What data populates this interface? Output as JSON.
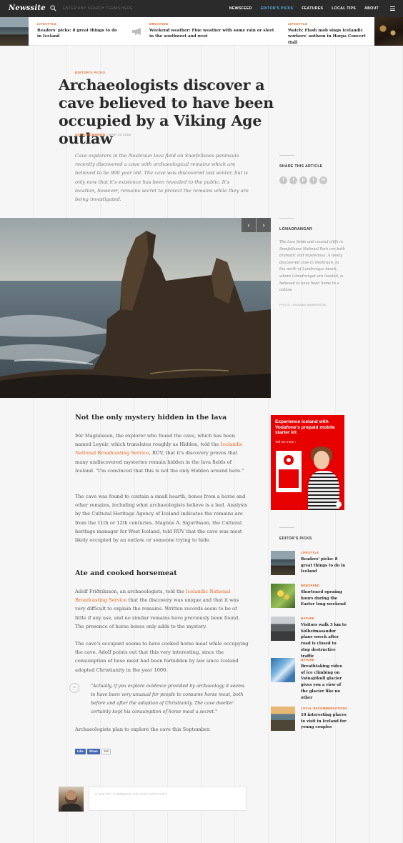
{
  "nav": {
    "logo": "Newssite",
    "search_placeholder": "ENTER ANY SEARCH TERMS HERE",
    "links": [
      "NEWSFEED",
      "EDITOR'S PICKS",
      "FEATURES",
      "LOCAL TIPS",
      "ABOUT"
    ],
    "active_link": "EDITOR'S PICKS"
  },
  "ticker": [
    {
      "category": "LIFESTYLE",
      "title": "Readers' picks: 8 great things to do in Iceland"
    },
    {
      "category": "BREAKING",
      "title": "Weekend weather: Fine weather with some rain or sleet in the southwest and west"
    },
    {
      "category": "LIFESTYLE",
      "title": "Watch: Flash mob sings Icelandic workers' anthem in Harpa Concert Hall"
    }
  ],
  "article": {
    "kicker": "EDITOR'S PICKS",
    "headline": "Archaeologists discover a cave believed to have been occupied by a Viking Age outlaw",
    "author": "SARA MCMAHON",
    "date": "MAR 16 2016",
    "lead": "Cave explorers in the Neshraun lava field on Snæfellsnes peninsula recently discovered a cave with archaeological remains which are believed to be 900 year old. The cave was discovered last winter, but is only now that it's existence has been revealed to the public. It's location, however, remains secret to protect the remains while they are being investigated.",
    "section1_title": "Not the only mystery hidden in the lava",
    "p1_before": "Þór Magnússon, the explorer who found the cave, which has been named Leynir, which translates roughly as Hidden, told the ",
    "p1_link": "Icelandic National Broadcasting Service",
    "p1_after": ", RÚV, that it's discovery proves that many undiscovered mysteries remain hidden in the lava fields of Iceland. \"I'm convinced that this is not the only Hidden around here.\"",
    "p2": "The cave was found to contain a small hearth, bones from a horse and other remains, including what archaeologists believe is a bed. Analysis by the Cultural Heritage Agency of Iceland indicates the remains are from the 11th or 12th centuries. Magnús A. Sigurðsson, the Cultural heritage manager for West Iceland, told RÚV that the cave was most likely occupied by an outlaw, or someone trying to hide.",
    "section2_title": "Ate and cooked horsemeat",
    "p3_before": "Adolf Friðriksson, an archaeologists, told the ",
    "p3_link": "Icelandic National Broadcasting Service",
    "p3_after": " that the discovery was unique and that it was very difficult to explain the remains. Written records seem to be of little if any use, and no similar remains have previously been found. The presence of horse bones only adds to the mystery.",
    "p4": "The cave's occupant seems to have cooked horse meat while occupying the cave. Adolf points out that this very interesting, since the consumption of hose meat had been forbidden by law since Iceland adopted Christianity in the year 1000.",
    "quote": "\"Actually, if you explore evidence provided by archaeology it seems to have been very unusual for people to consume horse meat, both before and after the adoption of Christianity. The cave dweller certainly kept his consumption of horse meat a secret.\"",
    "p5": "Archaeologists plan to explore the cave this September."
  },
  "share": {
    "title": "SHARE THIS ARTICLE",
    "icons": [
      "f",
      "t",
      "p",
      "t",
      "in"
    ]
  },
  "image_caption": {
    "title": "LÓNADRANGAR",
    "text": "The lava fields and coastal cliffs in Snæfellsnes National Park are both dramatic and mysterious. A newly discovered cave in Neshraun, to the north of Lóndrangar beach, where Lónadrangar are located, is believed to have been home to a outlaw.",
    "credit": "PHOTO  /  GUNNAR ANDRÉSSON",
    "prev": "‹",
    "next": "›"
  },
  "social": {
    "like": "Like",
    "share": "Share",
    "count": "266"
  },
  "comment": {
    "placeholder": "CARE TO COMMENT ON THIS ARTICLE?"
  },
  "ad": {
    "title": "Experience Iceland with Vodafone's prepaid mobile starter kit",
    "cta": "Tell me more ›"
  },
  "editors_picks": {
    "title": "EDITOR'S PICKS",
    "items": [
      {
        "category": "LIFESTYLE",
        "title": "Readers' picks: 8 great things to do in Iceland"
      },
      {
        "category": "NEWSFEED",
        "title": "Shortened opening hours during the Easter long weekend"
      },
      {
        "category": "NATURE",
        "title": "Visitors walk 3 km to Sólheimasandur plane wreck after road is closed to stop destructive traffic"
      },
      {
        "category": "NATURE",
        "title": "Breathtaking video of ice climbing on Vatnajökull glacier gives you a view of the glacier like no other"
      },
      {
        "category": "LOCAL RECOMMENDATIONS",
        "title": "10 interesting places to visit in Iceland for young couples"
      }
    ]
  },
  "colors": {
    "accent": "#e8641a",
    "nav_bg": "#2b2b2b",
    "active_link": "#52b0e6",
    "ad_bg": "#e60000"
  }
}
